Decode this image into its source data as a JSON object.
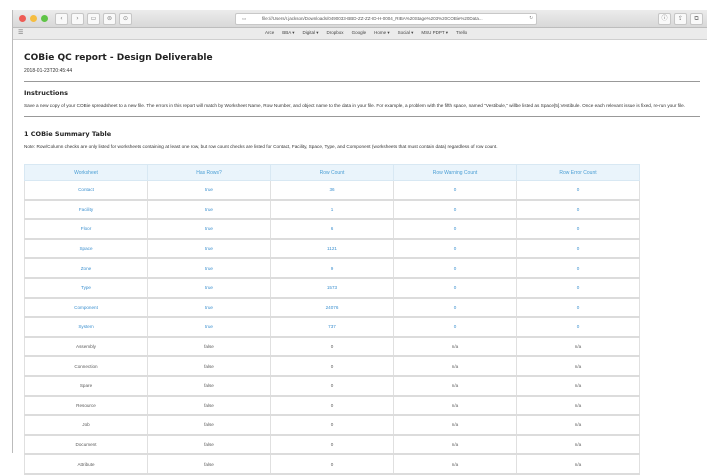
{
  "browser": {
    "address": "file:///Users/r.jackson/Downloads/0490033-BBD-ZZ-ZZ-ID-H-0004_RIBA%20Stage%203%20COBie%20Data...",
    "nav_back": "‹",
    "nav_forward": "›",
    "bookmarks": [
      "Arce",
      "BBA ▾",
      "Digital ▾",
      "Dropbox",
      "Google",
      "Home ▾",
      "Social ▾",
      "MSU PDPT ▾",
      "Trello"
    ]
  },
  "report": {
    "title": "COBie QC report - Design Deliverable",
    "date": "2018-01-23T20:45:44",
    "instructions_heading": "Instructions",
    "instructions_text": "Save a new copy of your COBie spreadsheet to a new file. The errors in this report will match by Worksheet Name, Row Number, and object name to the data in your file.  For example, a problem with the fifth space, named \"Vestibule,\" willbe listed as Space[5].Vestibule.  Once each relevant issue is fixed, re-run your file.",
    "summary_heading": "1 COBie Summary Table",
    "summary_note": "Note: Row/Column checks are only listed for worksheets containing at least one row, but row count checks are listed for Contact, Facility, Space, Type, and Component (worksheets that must contain data) regardless of row count."
  },
  "table": {
    "headers": [
      "Worksheet",
      "Has Rows?",
      "Row Count",
      "Row Warning Count",
      "Row Error Count"
    ],
    "rows": [
      [
        "Contact",
        "true",
        "36",
        "0",
        "0"
      ],
      [
        "Facility",
        "true",
        "1",
        "0",
        "0"
      ],
      [
        "Floor",
        "true",
        "6",
        "0",
        "0"
      ],
      [
        "Space",
        "true",
        "1121",
        "0",
        "0"
      ],
      [
        "Zone",
        "true",
        "9",
        "0",
        "0"
      ],
      [
        "Type",
        "true",
        "1573",
        "0",
        "0"
      ],
      [
        "Component",
        "true",
        "24076",
        "0",
        "0"
      ],
      [
        "System",
        "true",
        "737",
        "0",
        "0"
      ],
      [
        "Assembly",
        "false",
        "0",
        "n/a",
        "n/a"
      ],
      [
        "Connection",
        "false",
        "0",
        "n/a",
        "n/a"
      ],
      [
        "Spare",
        "false",
        "0",
        "n/a",
        "n/a"
      ],
      [
        "Resource",
        "false",
        "0",
        "n/a",
        "n/a"
      ],
      [
        "Job",
        "false",
        "0",
        "n/a",
        "n/a"
      ],
      [
        "Document",
        "false",
        "0",
        "n/a",
        "n/a"
      ],
      [
        "Attribute",
        "false",
        "0",
        "n/a",
        "n/a"
      ]
    ]
  },
  "colors": {
    "header_text": "#4a9ed4",
    "header_bg": "#eaf4fb",
    "link_text": "#3a8fcf"
  }
}
